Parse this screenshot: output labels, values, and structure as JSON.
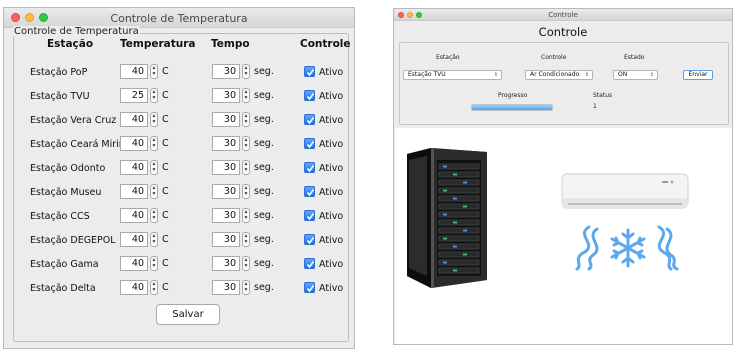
{
  "window1": {
    "title": "Controle de Temperatura",
    "group_label": "Controle de Temperatura",
    "headers": {
      "station": "Estação",
      "temperature": "Temperatura",
      "time": "Tempo",
      "control": "Controle"
    },
    "rows": [
      {
        "station": "Estação PoP",
        "temperature": "40",
        "temp_unit": "C",
        "time": "30",
        "time_unit": "seg.",
        "control": "Ativo",
        "checked": true
      },
      {
        "station": "Estação TVU",
        "temperature": "25",
        "temp_unit": "C",
        "time": "30",
        "time_unit": "seg.",
        "control": "Ativo",
        "checked": true
      },
      {
        "station": "Estação Vera Cruz",
        "temperature": "40",
        "temp_unit": "C",
        "time": "30",
        "time_unit": "seg.",
        "control": "Ativo",
        "checked": true
      },
      {
        "station": "Estação Ceará Mirim",
        "temperature": "40",
        "temp_unit": "C",
        "time": "30",
        "time_unit": "seg.",
        "control": "Ativo",
        "checked": true
      },
      {
        "station": "Estação Odonto",
        "temperature": "40",
        "temp_unit": "C",
        "time": "30",
        "time_unit": "seg.",
        "control": "Ativo",
        "checked": true
      },
      {
        "station": "Estação Museu",
        "temperature": "40",
        "temp_unit": "C",
        "time": "30",
        "time_unit": "seg.",
        "control": "Ativo",
        "checked": true
      },
      {
        "station": "Estação CCS",
        "temperature": "40",
        "temp_unit": "C",
        "time": "30",
        "time_unit": "seg.",
        "control": "Ativo",
        "checked": true
      },
      {
        "station": "Estação DEGEPOL",
        "temperature": "40",
        "temp_unit": "C",
        "time": "30",
        "time_unit": "seg.",
        "control": "Ativo",
        "checked": true
      },
      {
        "station": "Estação Gama",
        "temperature": "40",
        "temp_unit": "C",
        "time": "30",
        "time_unit": "seg.",
        "control": "Ativo",
        "checked": true
      },
      {
        "station": "Estação Delta",
        "temperature": "40",
        "temp_unit": "C",
        "time": "30",
        "time_unit": "seg.",
        "control": "Ativo",
        "checked": true
      }
    ],
    "save_label": "Salvar"
  },
  "window2": {
    "title": "Controle",
    "heading": "Controle",
    "labels": {
      "station": "Estação",
      "control": "Controle",
      "state": "Estado",
      "progress": "Progresso",
      "status": "Status"
    },
    "station_value": "Estação TVU",
    "control_value": "Ar Condicionado",
    "state_value": "ON",
    "send_label": "Enviar",
    "status_value": "1",
    "progress_fraction": 1.0
  },
  "colors": {
    "accent": "#2c7be5",
    "checkbox": "#2c7be5",
    "window_bg": "#ececec",
    "progress_fill": "#4da2f0",
    "snow": "#5aa9f0"
  },
  "icons": [
    "server-rack-icon",
    "air-conditioner-icon",
    "snowflake-icon",
    "cold-wave-icon"
  ]
}
